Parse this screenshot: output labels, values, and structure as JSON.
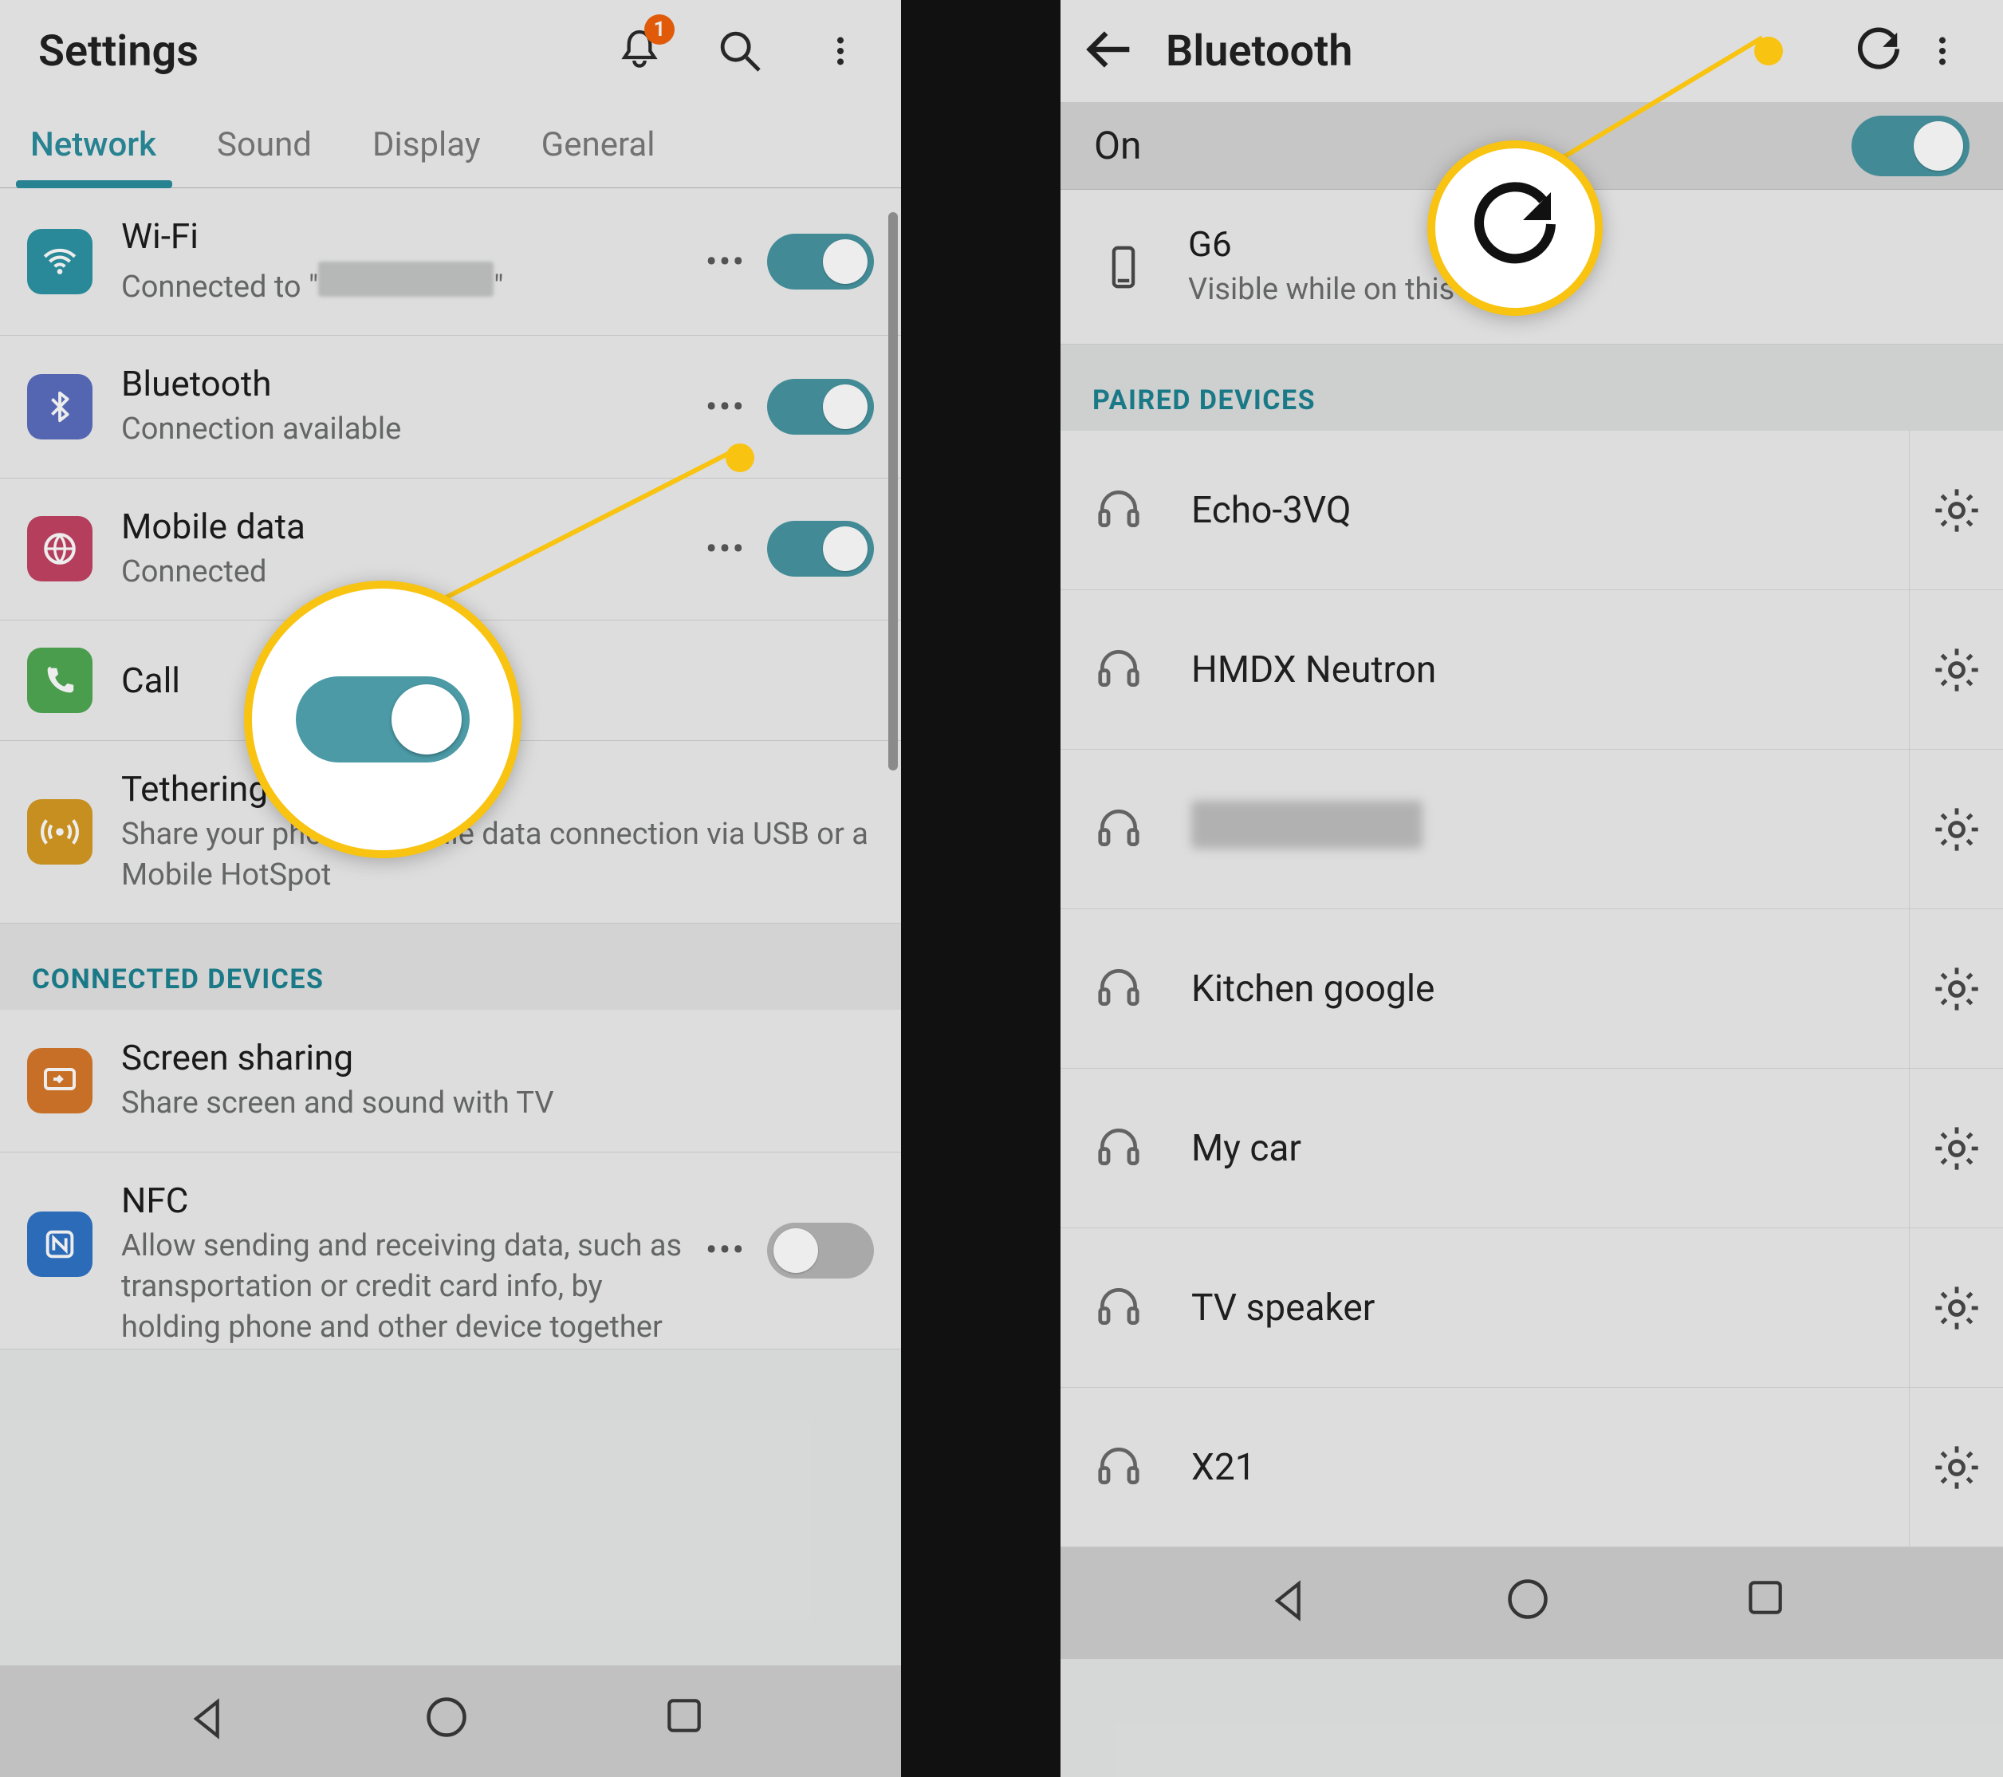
{
  "left": {
    "header": {
      "title": "Settings",
      "badge": "1"
    },
    "tabs": [
      "Network",
      "Sound",
      "Display",
      "General"
    ],
    "activeTab": 0,
    "rows": {
      "wifi": {
        "title": "Wi-Fi",
        "sub_prefix": "Connected to \"",
        "sub_suffix": "\""
      },
      "bt": {
        "title": "Bluetooth",
        "sub": "Connection available"
      },
      "data": {
        "title": "Mobile data",
        "sub": "Connected"
      },
      "call": {
        "title": "Call"
      },
      "tether": {
        "title": "Tethering",
        "sub": "Share your phone's mobile data connection via USB or a Mobile HotSpot"
      },
      "screen": {
        "title": "Screen sharing",
        "sub": "Share screen and sound with TV"
      },
      "nfc": {
        "title": "NFC",
        "sub": "Allow sending and receiving data, such as transportation or credit card info, by holding phone and other device together"
      }
    },
    "sections": {
      "connected": "CONNECTED DEVICES"
    }
  },
  "right": {
    "title": "Bluetooth",
    "status": "On",
    "self": {
      "name": "G6",
      "sub": "Visible while on this screen"
    },
    "section": "PAIRED DEVICES",
    "devices": [
      "Echo-3VQ",
      "HMDX Neutron",
      "",
      "Kitchen google",
      "My car",
      "TV speaker",
      "X21"
    ]
  }
}
